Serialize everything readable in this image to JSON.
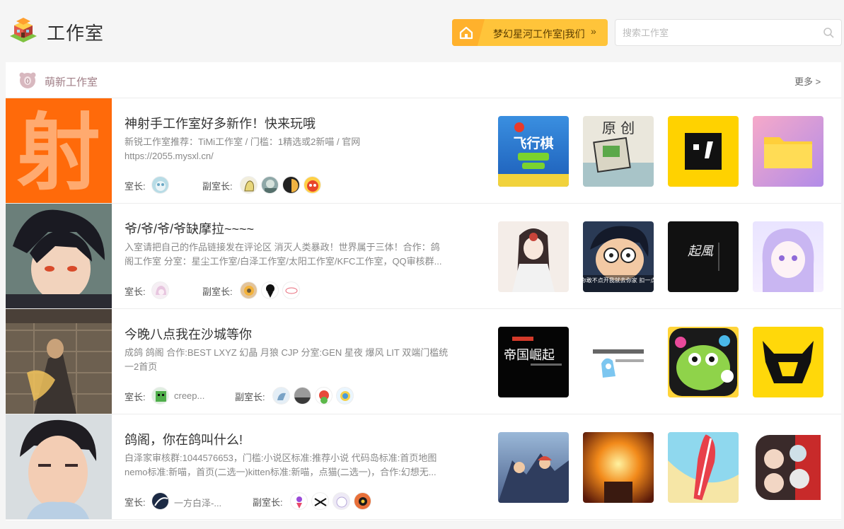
{
  "header": {
    "title": "工作室",
    "studio_button": "梦幻星河工作室|我们",
    "search_placeholder": "搜索工作室"
  },
  "section": {
    "title": "萌新工作室",
    "more": "更多 >"
  },
  "labels": {
    "owner": "室长:",
    "vice_owner": "副室长:"
  },
  "rows": [
    {
      "title": "神射手工作室好多新作！快来玩哦",
      "desc_lines": [
        "新锐工作室推荐：TiMi工作室 / 门槛：1精选或2新喵 / 官网",
        "https://2055.mysxl.cn/"
      ],
      "owner_name": "",
      "cover_text": "射",
      "game_texts": [
        "飞行棋",
        "原 创",
        "",
        ""
      ]
    },
    {
      "title": "爷/爷/爷/爷缺摩拉~~~~",
      "desc_lines": [
        "入室请把自己的作品链接发在评论区 消灭人类暴政！世界属于三体！合作：鸽",
        "阁工作室 分室：星尘工作室/白泽工作室/太阳工作室/KFC工作室，QQ审核群..."
      ],
      "owner_name": "",
      "cover_text": "",
      "game_texts": [
        "",
        "你敢不点开我就去你家 扣一点",
        "起風",
        ""
      ]
    },
    {
      "title": "今晚八点我在沙城等你",
      "desc_lines": [
        "成鸽 鸽阁 合作:BEST LXYZ 幻晶 月狼 CJP 分室:GEN 星夜 爆风 LIT 双端门槛统",
        "一2首页"
      ],
      "owner_name": "creep...",
      "cover_text": "",
      "game_texts": [
        "帝国崛起",
        "",
        "",
        ""
      ]
    },
    {
      "title": "鸽阁，你在鸽叫什么!",
      "desc_lines": [
        "白泽家审核群:1044576653，门槛:小说区标准:推荐小说 代码岛标准:首页地图",
        "nemo标准:新喵，首页(二选一)kitten标准:新喵，点猫(二选一)，合作:幻想无..."
      ],
      "owner_name": "一方白泽-...",
      "cover_text": "",
      "game_texts": [
        "",
        "",
        "",
        ""
      ]
    }
  ]
}
